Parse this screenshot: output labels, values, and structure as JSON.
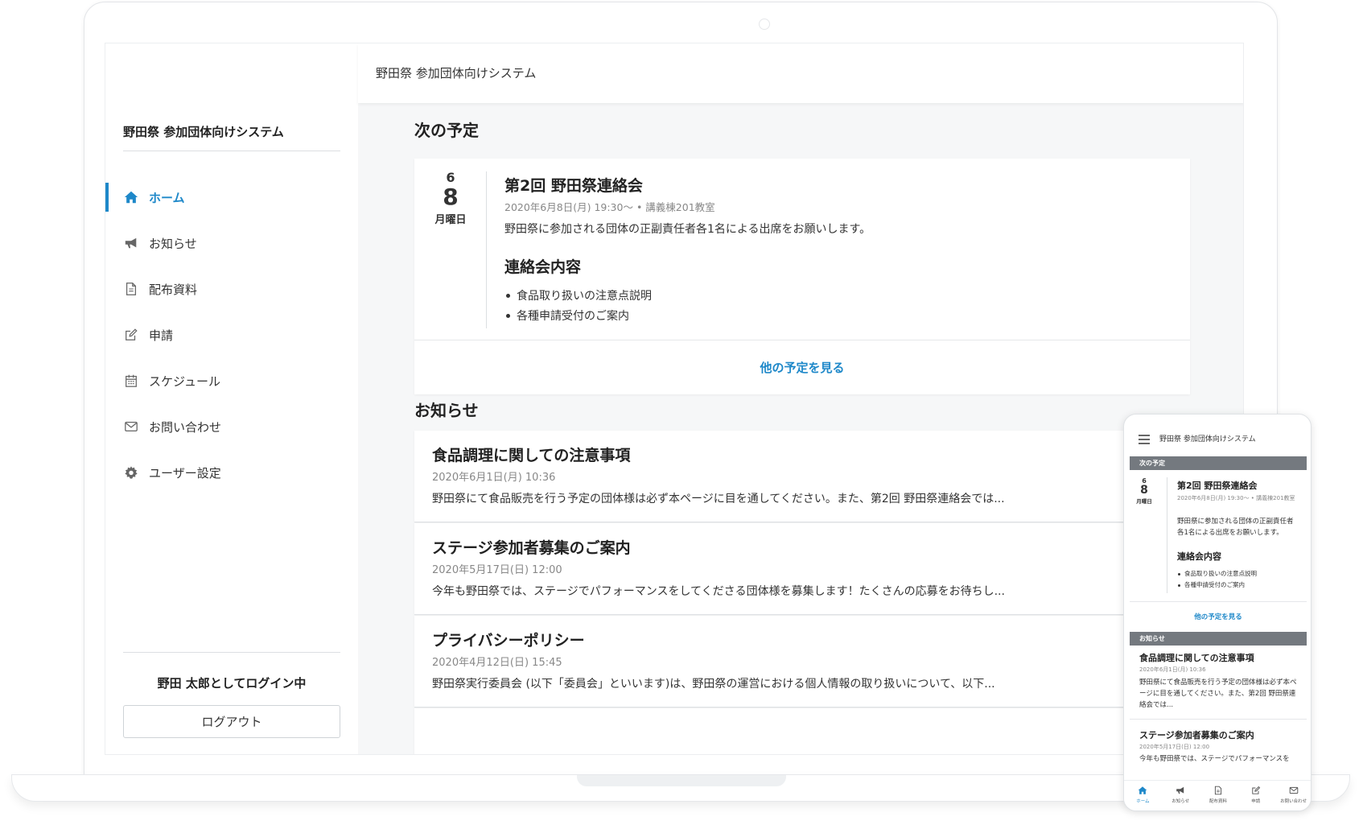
{
  "app": {
    "title": "野田祭 参加団体向けシステム",
    "accent_color": "#1e88c9"
  },
  "sidebar": {
    "title": "野田祭 参加団体向けシステム",
    "items": [
      {
        "label": "ホーム",
        "icon": "home-icon",
        "active": true
      },
      {
        "label": "お知らせ",
        "icon": "megaphone-icon",
        "active": false
      },
      {
        "label": "配布資料",
        "icon": "document-icon",
        "active": false
      },
      {
        "label": "申請",
        "icon": "edit-icon",
        "active": false
      },
      {
        "label": "スケジュール",
        "icon": "calendar-icon",
        "active": false
      },
      {
        "label": "お問い合わせ",
        "icon": "envelope-icon",
        "active": false
      },
      {
        "label": "ユーザー設定",
        "icon": "gear-icon",
        "active": false
      }
    ],
    "login_status": "野田 太郎としてログイン中",
    "logout_label": "ログアウト"
  },
  "topbar": {
    "title": "野田祭 参加団体向けシステム"
  },
  "schedule": {
    "section_title": "次の予定",
    "event": {
      "month": "6",
      "day": "8",
      "weekday": "月曜日",
      "title": "第2回 野田祭連絡会",
      "meta": "2020年6月8日(月) 19:30〜 • 講義棟201教室",
      "description": "野田祭に参加される団体の正副責任者各1名による出席をお願いします。",
      "subtitle": "連絡会内容",
      "items": [
        "食品取り扱いの注意点説明",
        "各種申請受付のご案内"
      ]
    },
    "more_label": "他の予定を見る"
  },
  "news": {
    "section_title": "お知らせ",
    "items": [
      {
        "title": "食品調理に関しての注意事項",
        "date": "2020年6月1日(月) 10:36",
        "body": "野田祭にて食品販売を行う予定の団体様は必ず本ページに目を通してください。また、第2回 野田祭連絡会では..."
      },
      {
        "title": "ステージ参加者募集のご案内",
        "date": "2020年5月17日(日) 12:00",
        "body": "今年も野田祭では、ステージでパフォーマンスをしてくださる団体様を募集します！たくさんの応募をお待ちし..."
      },
      {
        "title": "プライバシーポリシー",
        "date": "2020年4月12日(日) 15:45",
        "body": "野田祭実行委員会 (以下「委員会」といいます)は、野田祭の運営における個人情報の取り扱いについて、以下..."
      }
    ]
  },
  "mobile": {
    "title": "野田祭 参加団体向けシステム",
    "schedule_bar": "次の予定",
    "event": {
      "month": "6",
      "day": "8",
      "weekday": "月曜日",
      "title": "第2回 野田祭連絡会",
      "meta": "2020年6月8日(月) 19:30〜 • 講義棟201教室",
      "description": "野田祭に参加される団体の正副責任者各1名による出席をお願いします。",
      "subtitle": "連絡会内容",
      "items": [
        "食品取り扱いの注意点説明",
        "各種申請受付のご案内"
      ]
    },
    "more_label": "他の予定を見る",
    "news_bar": "お知らせ",
    "news": [
      {
        "title": "食品調理に関しての注意事項",
        "date": "2020年6月1日(月) 10:36",
        "body": "野田祭にて食品販売を行う予定の団体様は必ず本ページに目を通してください。また、第2回 野田祭連絡会では..."
      },
      {
        "title": "ステージ参加者募集のご案内",
        "date": "2020年5月17日(日) 12:00",
        "body": "今年も野田祭では、ステージでパフォーマンスを"
      }
    ],
    "tabs": [
      {
        "label": "ホーム",
        "icon": "home-icon",
        "active": true
      },
      {
        "label": "お知らせ",
        "icon": "megaphone-icon",
        "active": false
      },
      {
        "label": "配布資料",
        "icon": "document-icon",
        "active": false
      },
      {
        "label": "申請",
        "icon": "edit-icon",
        "active": false
      },
      {
        "label": "お問い合わせ",
        "icon": "envelope-icon",
        "active": false
      }
    ]
  }
}
